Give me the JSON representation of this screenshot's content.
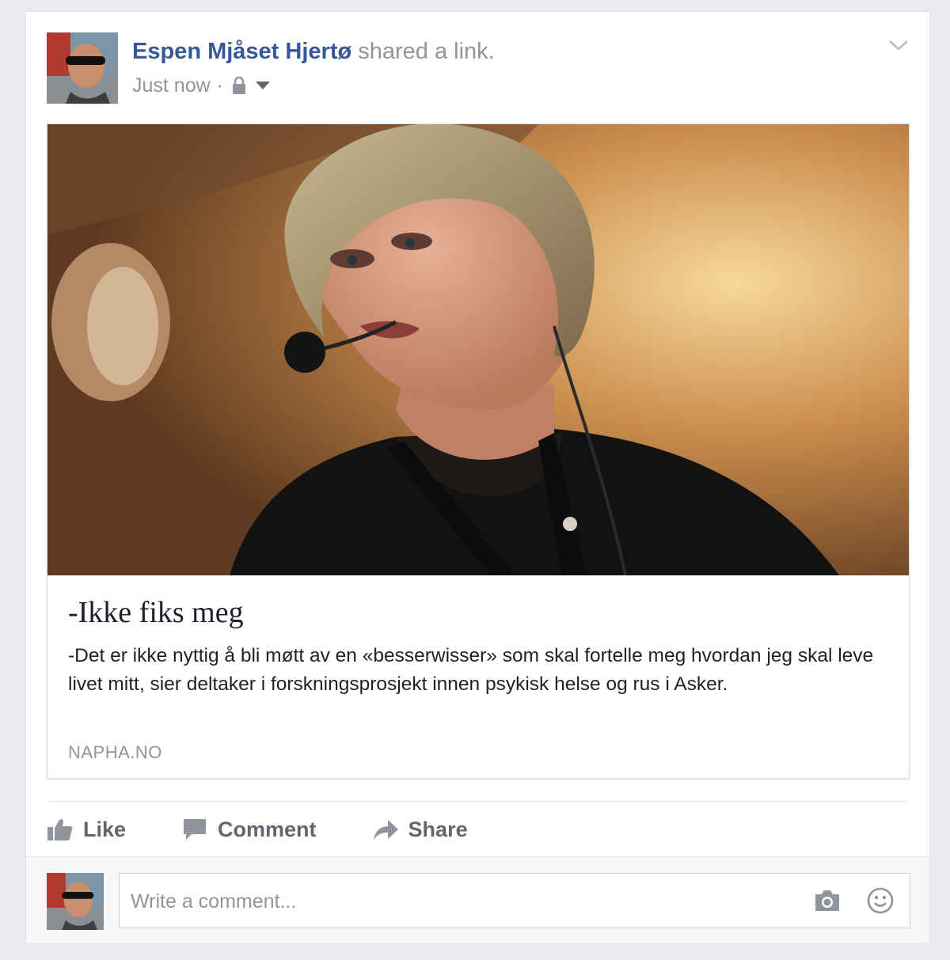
{
  "post": {
    "author": "Espen Mjåset Hjertø",
    "action": "shared a link.",
    "timestamp": "Just now",
    "separator": "·",
    "privacy_icon": "lock-icon",
    "audience_icon": "caret-down-icon",
    "options_icon": "chevron-down-icon"
  },
  "link": {
    "title": "-Ikke fiks meg",
    "description": "-Det er ikke nyttig å bli møtt av en «besserwisser» som skal fortelle meg hvordan jeg skal leve livet mitt, sier deltaker i forskningsprosjekt innen psykisk helse og rus i Asker.",
    "domain": "NAPHA.NO"
  },
  "actions": {
    "like": "Like",
    "comment": "Comment",
    "share": "Share"
  },
  "comment_box": {
    "placeholder": "Write a comment...",
    "camera_icon": "camera-icon",
    "emoji_icon": "smiley-icon"
  },
  "colors": {
    "author_link": "#365899",
    "muted": "#90949c",
    "action_text": "#606770",
    "background": "#e9ebee"
  }
}
